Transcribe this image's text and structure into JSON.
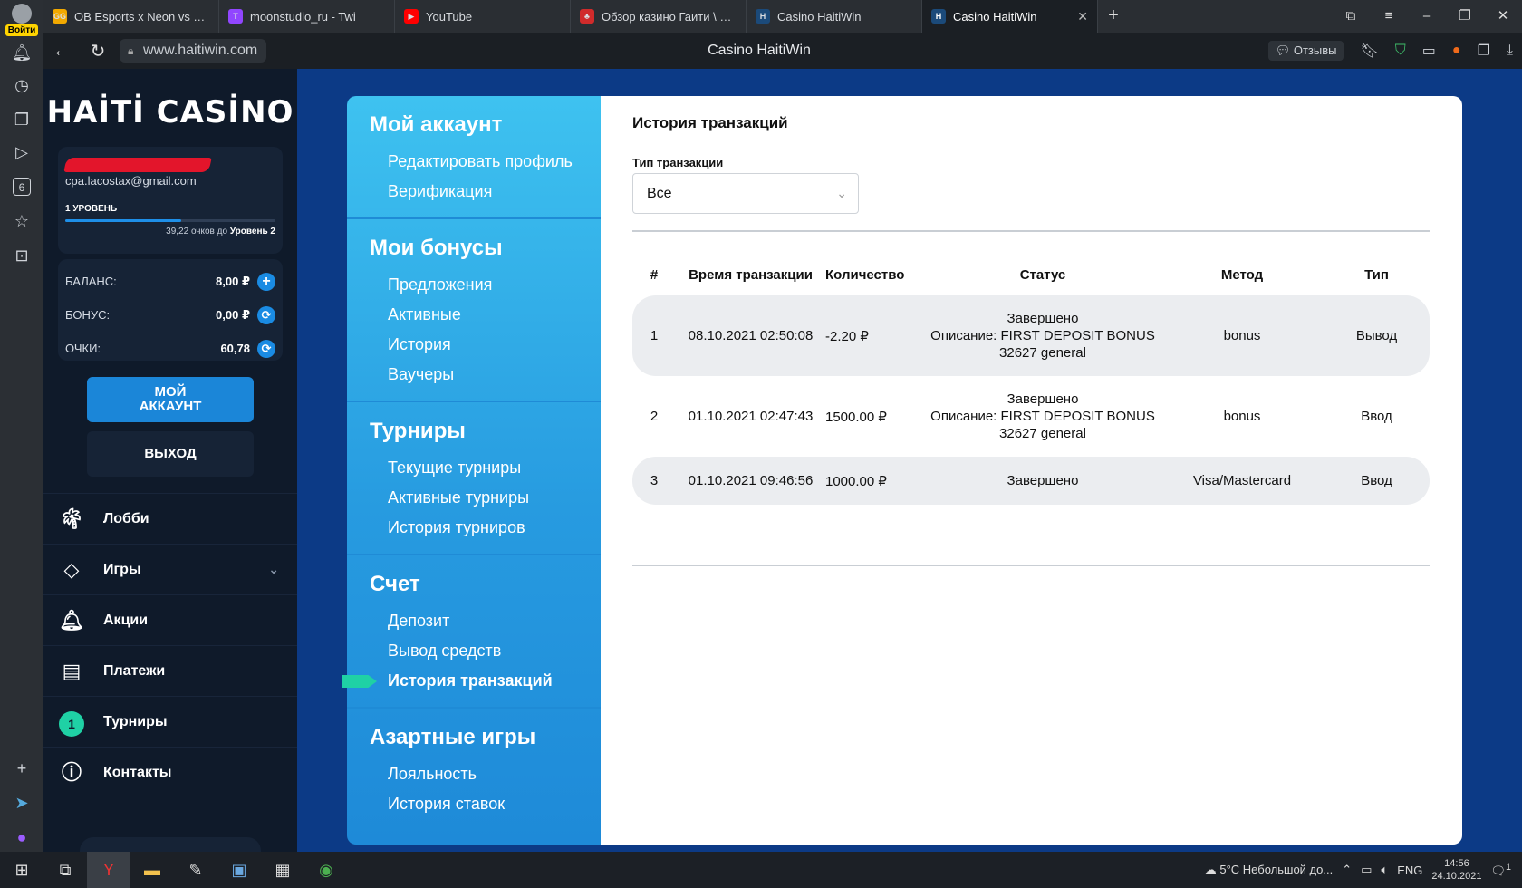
{
  "browser": {
    "profile_label": "Войти",
    "tabs": [
      {
        "favicon": "GG",
        "favicon_color": "#f2a900",
        "title": "OB Esports x Neon vs Team"
      },
      {
        "favicon": "T",
        "favicon_color": "#9146ff",
        "title": "moonstudio_ru - Twi"
      },
      {
        "favicon": "▶",
        "favicon_color": "#ff0000",
        "title": "YouTube"
      },
      {
        "favicon": "♣",
        "favicon_color": "#d02b2b",
        "title": "Обзор казино Гаити \\ HAI"
      },
      {
        "favicon": "H",
        "favicon_color": "#1b4a7a",
        "title": "Casino HaitiWin"
      },
      {
        "favicon": "H",
        "favicon_color": "#1b4a7a",
        "title": "Casino HaitiWin",
        "active": true
      }
    ],
    "url": "www.haitiwin.com",
    "page_title": "Casino HaitiWin",
    "reviews_label": "Отзывы",
    "rail_number": "6"
  },
  "sidebar": {
    "logo_text": "HAİTİ CASİNO",
    "email": "cpa.lacostax@gmail.com",
    "level_label": "1 УРОВЕНЬ",
    "level_progress": 0.55,
    "level_points": "39,22 очков до",
    "next_level": "Уровень 2",
    "balance_label": "БАЛАНС:",
    "balance_value": "8,00 ₽",
    "bonus_label": "БОНУС:",
    "bonus_value": "0,00 ₽",
    "points_label": "ОЧКИ:",
    "points_value": "60,78",
    "btn_account": "МОЙ АККАУНТ",
    "btn_logout": "ВЫХОД",
    "nav": [
      {
        "label": "Лобби",
        "icon": "palm-tree-icon"
      },
      {
        "label": "Игры",
        "icon": "diamond-icon"
      },
      {
        "label": "Акции",
        "icon": "bell-icon"
      },
      {
        "label": "Платежи",
        "icon": "cash-icon"
      },
      {
        "label": "Турниры",
        "badge": "1"
      },
      {
        "label": "Контакты",
        "icon": "info-icon"
      }
    ]
  },
  "account_menu": [
    {
      "head": "Мой аккаунт",
      "links": [
        "Редактировать профиль",
        "Верификация"
      ]
    },
    {
      "head": "Мои бонусы",
      "links": [
        "Предложения",
        "Активные",
        "История",
        "Ваучеры"
      ]
    },
    {
      "head": "Турниры",
      "links": [
        "Текущие турниры",
        "Активные турниры",
        "История турниров"
      ]
    },
    {
      "head": "Счет",
      "links": [
        "Депозит",
        "Вывод средств",
        "История транзакций"
      ],
      "active": "История транзакций"
    },
    {
      "head": "Азартные игры",
      "links": [
        "Лояльность",
        "История ставок"
      ]
    }
  ],
  "content": {
    "title": "История транзакций",
    "filter_label": "Тип транзакции",
    "filter_value": "Все",
    "columns": [
      "#",
      "Время транзакции",
      "Количество",
      "Статус",
      "Метод",
      "Тип"
    ],
    "rows": [
      {
        "n": "1",
        "time": "08.10.2021 02:50:08",
        "amount": "-2.20 ₽",
        "status": "Завершено",
        "desc": "Описание: FIRST DEPOSIT BONUS",
        "desc2": "32627 general",
        "method": "bonus",
        "type": "Вывод"
      },
      {
        "n": "2",
        "time": "01.10.2021 02:47:43",
        "amount": "1500.00 ₽",
        "status": "Завершено",
        "desc": "Описание: FIRST DEPOSIT BONUS",
        "desc2": "32627 general",
        "method": "bonus",
        "type": "Ввод"
      },
      {
        "n": "3",
        "time": "01.10.2021 09:46:56",
        "amount": "1000.00 ₽",
        "status": "Завершено",
        "desc": "",
        "desc2": "",
        "method": "Visa/Mastercard",
        "type": "Ввод"
      }
    ]
  },
  "taskbar": {
    "weather": "5°C  Небольшой до...",
    "lang": "ENG",
    "time": "14:56",
    "date": "24.10.2021",
    "notifications": "1"
  }
}
